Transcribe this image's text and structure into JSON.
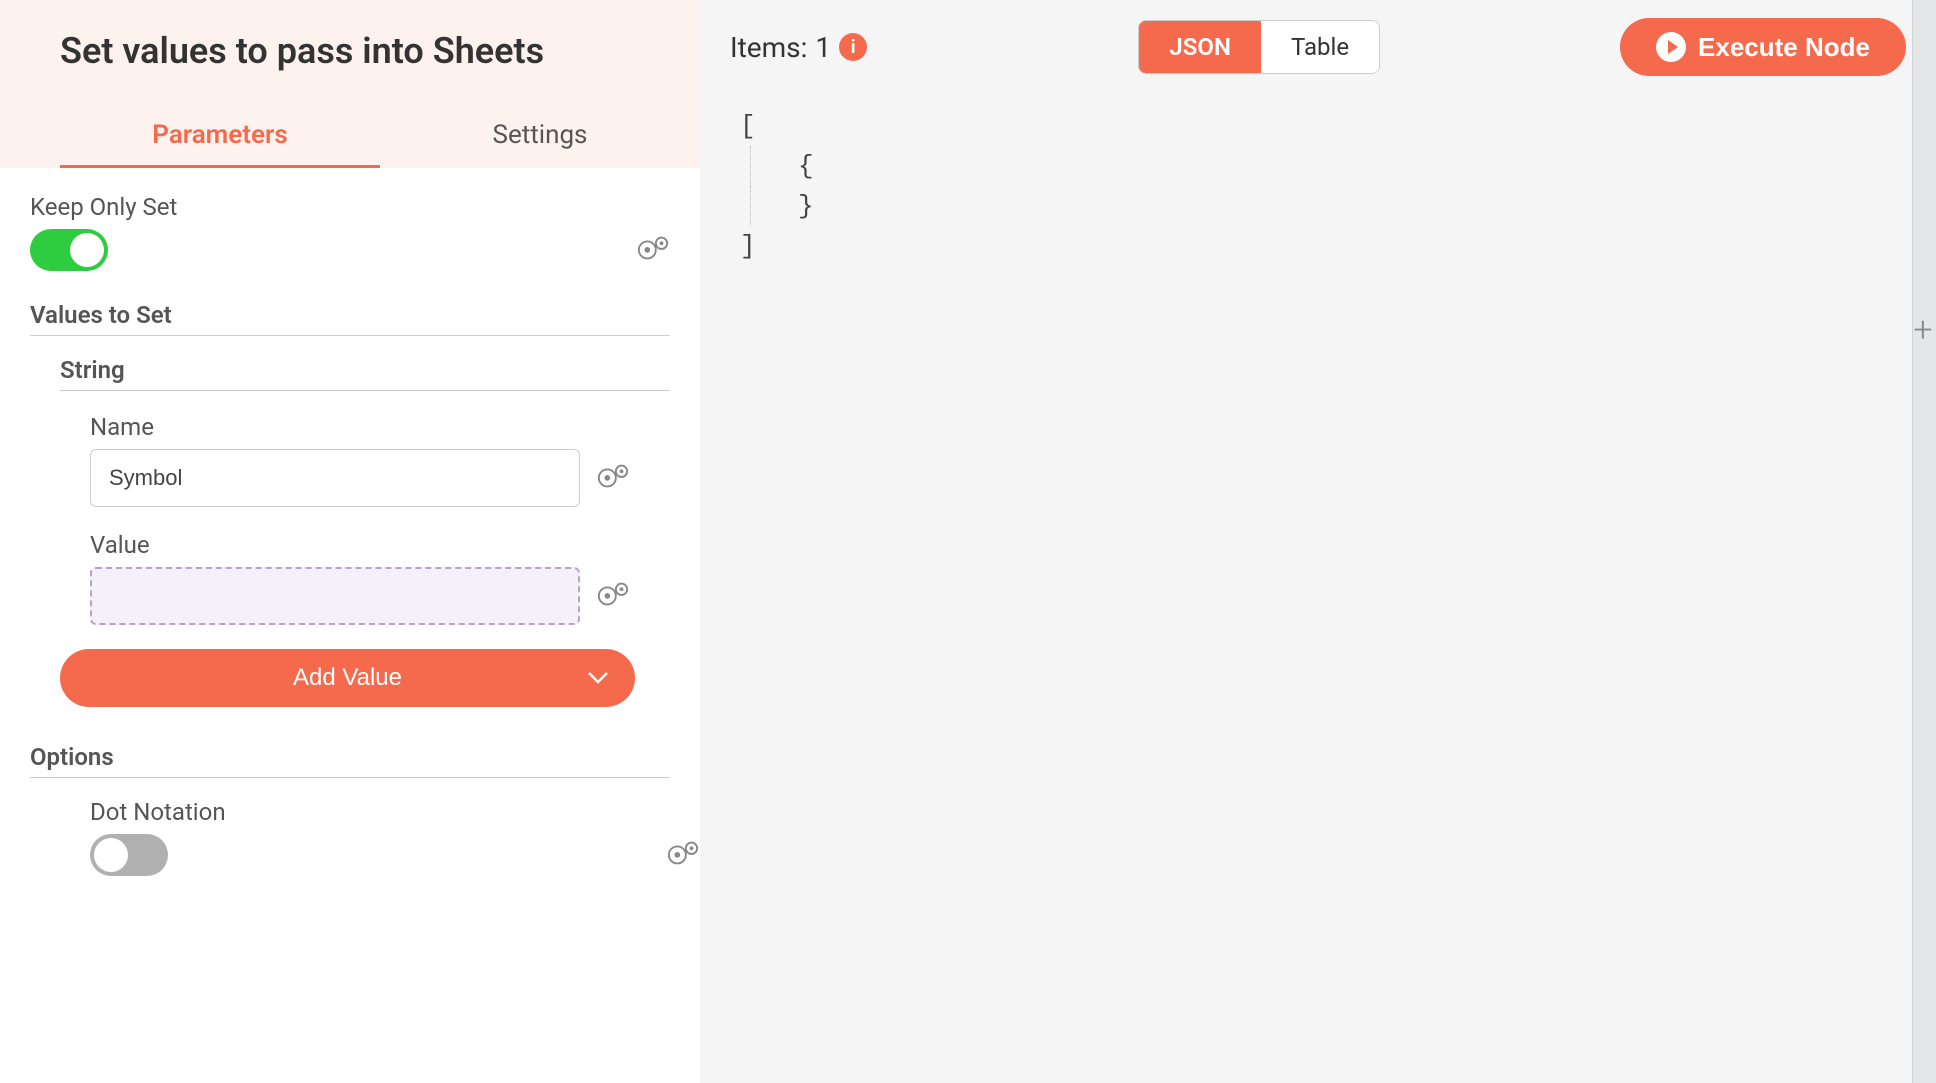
{
  "panel": {
    "title": "Set values to pass into Sheets",
    "tabs": {
      "parameters": "Parameters",
      "settings": "Settings"
    }
  },
  "params": {
    "keepOnlySet": {
      "label": "Keep Only Set"
    },
    "valuesToSet": {
      "header": "Values to Set",
      "string_header": "String"
    },
    "string_item": {
      "name_label": "Name",
      "name_value": "Symbol",
      "value_label": "Value",
      "value_value": ""
    },
    "addValueBtn": "Add Value",
    "options": {
      "header": "Options",
      "dotNotation": {
        "label": "Dot Notation"
      }
    }
  },
  "output": {
    "items_prefix": "Items: ",
    "items_count": "1",
    "view_json": "JSON",
    "view_table": "Table",
    "execute_label": "Execute Node",
    "code_lines": {
      "l1": "[",
      "l2": "{",
      "l3": "}",
      "l4": "]"
    }
  }
}
